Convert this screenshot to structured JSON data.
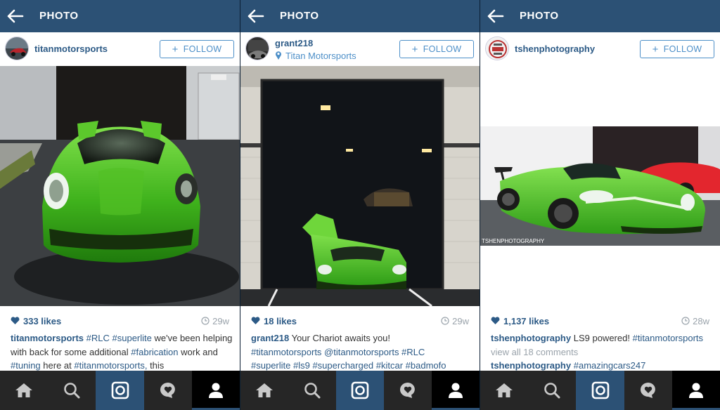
{
  "colors": {
    "topbar": "#2c5175",
    "link": "#2c5a86",
    "follow": "#4d8fc8",
    "muted": "#9aa3ab",
    "nav_bg": "#262626",
    "nav_active": "#2c5175",
    "car_green": "#4cc22a"
  },
  "icons": {
    "back": "arrow-left-icon",
    "location": "map-pin-icon",
    "likes": "heart-icon",
    "time": "clock-icon",
    "nav": [
      "home-icon",
      "search-icon",
      "camera-icon",
      "activity-heart-bubble-icon",
      "profile-icon"
    ]
  },
  "panels": [
    {
      "title": "PHOTO",
      "username": "titanmotorsports",
      "location": "",
      "follow_label": "FOLLOW",
      "likes": "333 likes",
      "time": "29w",
      "caption": {
        "user": "titanmotorsports",
        "tag1": "#RLC",
        "tag2": "#superlite",
        "text1": "we've been helping with back for some additional",
        "tag3": "#fabrication",
        "text2": "work and",
        "tag4": "#tuning",
        "text3": "here at",
        "tag5": "#titanmotorsports,",
        "text4": "this"
      }
    },
    {
      "title": "PHOTO",
      "username": "grant218",
      "location": "Titan Motorsports",
      "follow_label": "FOLLOW",
      "likes": "18 likes",
      "time": "29w",
      "caption": {
        "user": "grant218",
        "text1": "Your Chariot awaits you!",
        "tags_line2": "#titanmotorsports @titanmotorsports #RLC",
        "tags_line3": "#superlite #ls9 #supercharged #kitcar #badmofo"
      }
    },
    {
      "title": "PHOTO",
      "username": "tshenphotography",
      "location": "",
      "follow_label": "FOLLOW",
      "likes": "1,137 likes",
      "time": "28w",
      "watermark": "TSHENPHOTOGRAPHY",
      "caption": {
        "user": "tshenphotography",
        "text1": "LS9 powered!",
        "tag1": "#titanmotorsports",
        "view_comments": "view all 18 comments",
        "user2": "tshenphotography",
        "tag2": "#amazingcars247"
      }
    }
  ]
}
